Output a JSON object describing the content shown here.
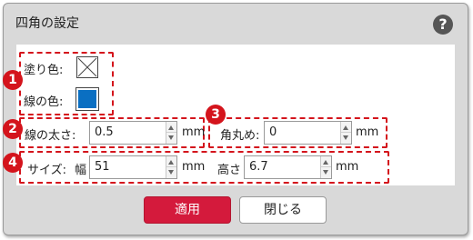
{
  "dialog": {
    "title": "四角の設定",
    "help_icon": "?"
  },
  "fill": {
    "label": "塗り色:",
    "swatch": "none"
  },
  "line_color": {
    "label": "線の色:",
    "color": "#0a6fc2"
  },
  "line_width": {
    "label": "線の太さ:",
    "value": "0.5",
    "unit": "mm"
  },
  "corner": {
    "label": "角丸め:",
    "value": "0",
    "unit": "mm"
  },
  "size": {
    "label": "サイズ:",
    "width_label": "幅",
    "width_value": "51",
    "width_unit": "mm",
    "height_label": "高さ",
    "height_value": "6.7",
    "height_unit": "mm"
  },
  "annotations": [
    "1",
    "2",
    "3",
    "4"
  ],
  "buttons": {
    "apply": "適用",
    "close": "閉じる"
  },
  "colors": {
    "accent": "#d4141c",
    "primary_button": "#d41a3c"
  }
}
